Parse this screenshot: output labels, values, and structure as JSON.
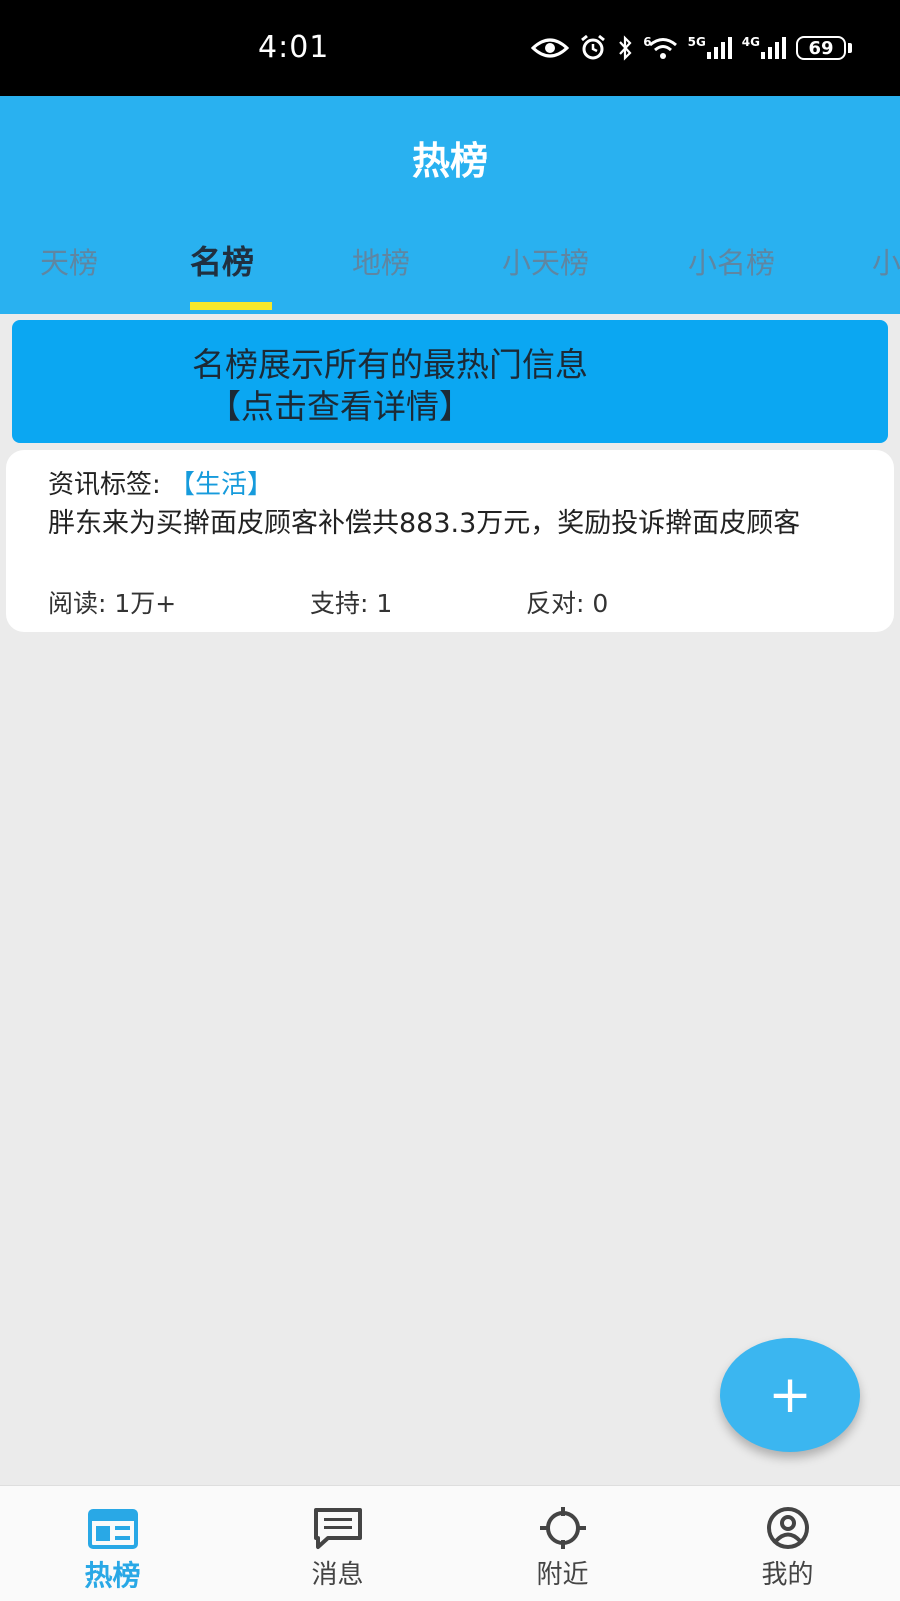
{
  "status_bar": {
    "time": "4:01",
    "battery": "69",
    "net_5g": "5G",
    "net_4g": "4G",
    "wifi_num": "6"
  },
  "header": {
    "title": "热榜"
  },
  "tabs": [
    {
      "label": "天榜",
      "active": false
    },
    {
      "label": "名榜",
      "active": true
    },
    {
      "label": "地榜",
      "active": false
    },
    {
      "label": "小天榜",
      "active": false
    },
    {
      "label": "小名榜",
      "active": false
    },
    {
      "label": "小",
      "active": false
    }
  ],
  "banner": {
    "line1": "名榜展示所有的最热门信息",
    "line2": "【点击查看详情】"
  },
  "news": [
    {
      "tag_label": "资讯标签:",
      "tag_value": "【生活】",
      "title": "胖东来为买擀面皮顾客补偿共883.3万元，奖励投诉擀面皮顾客",
      "read_label": "阅读: ",
      "read_value": "1万+",
      "support_label": "支持: ",
      "support_value": "1",
      "oppose_label": "反对: ",
      "oppose_value": "0"
    }
  ],
  "fab": {
    "label": "+"
  },
  "bottom_nav": [
    {
      "label": "热榜",
      "icon": "newspaper-icon",
      "active": true
    },
    {
      "label": "消息",
      "icon": "message-icon",
      "active": false
    },
    {
      "label": "附近",
      "icon": "crosshair-icon",
      "active": false
    },
    {
      "label": "我的",
      "icon": "user-icon",
      "active": false
    }
  ],
  "colors": {
    "header": "#29b1f0",
    "banner": "#0ba7f2",
    "indicator": "#f6e82a",
    "accent": "#29a8e6"
  }
}
